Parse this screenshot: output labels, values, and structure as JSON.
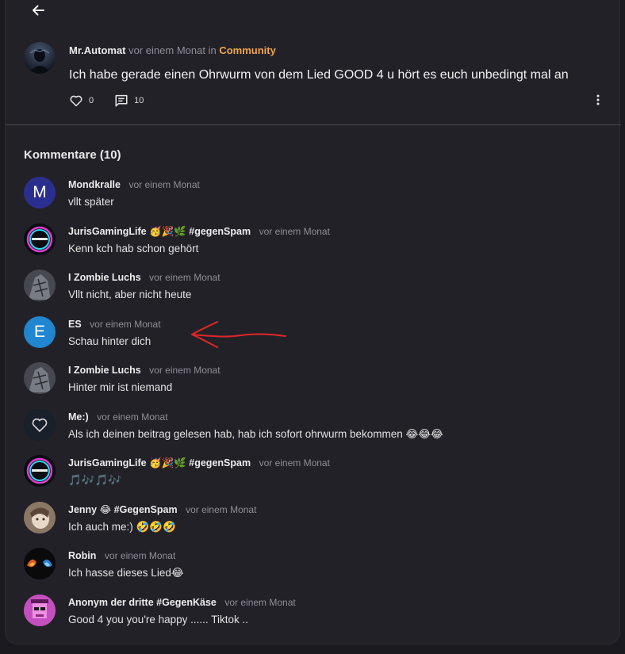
{
  "header": {
    "back_icon": "arrow-left-icon"
  },
  "post": {
    "author": "Mr.Automat",
    "time": "vor einem Monat",
    "in_word": "in",
    "community": "Community",
    "text": "Ich habe gerade einen Ohrwurm von dem Lied GOOD 4 u hört es euch unbedingt mal an",
    "likes": "0",
    "comments": "10",
    "colors": {
      "accent": "#f0a64d",
      "background": "#232128"
    }
  },
  "comments_section": {
    "title": "Kommentare (10)",
    "items": [
      {
        "name": "Mondkralle",
        "time": "vor einem Monat",
        "text": "vllt später"
      },
      {
        "name": "JurisGamingLife 🥳🎉🌿 #gegenSpam",
        "time": "vor einem Monat",
        "text": "Kenn kch hab schon gehört"
      },
      {
        "name": "I Zombie Luchs",
        "time": "vor einem Monat",
        "text": "Vllt nicht, aber nicht heute"
      },
      {
        "name": "ES",
        "time": "vor einem Monat",
        "text": "Schau hinter dich"
      },
      {
        "name": "I Zombie Luchs",
        "time": "vor einem Monat",
        "text": "Hinter mir ist niemand"
      },
      {
        "name": "Me:)",
        "time": "vor einem Monat",
        "text": "Als ich deinen beitrag gelesen hab, hab ich sofort ohrwurm bekommen 😂😂😂"
      },
      {
        "name": "JurisGamingLife 🥳🎉🌿 #gegenSpam",
        "time": "vor einem Monat",
        "text": "🎵🎶🎵🎶"
      },
      {
        "name": "Jenny 😂 #GegenSpam",
        "time": "vor einem Monat",
        "text": "Ich auch me:) 🤣🤣🤣"
      },
      {
        "name": "Robin",
        "time": "vor einem Monat",
        "text": "Ich hasse dieses Lied😂"
      },
      {
        "name": "Anonym der dritte #GegenKäse",
        "time": "vor einem Monat",
        "text": "Good 4 you you're happy ...... Tiktok .."
      }
    ],
    "avatars": {
      "M": {
        "letter": "M",
        "color": "#2a2f8f"
      },
      "E": {
        "letter": "E",
        "color": "#1f86cf"
      }
    }
  },
  "annotation": {
    "color": "#e0262a"
  }
}
